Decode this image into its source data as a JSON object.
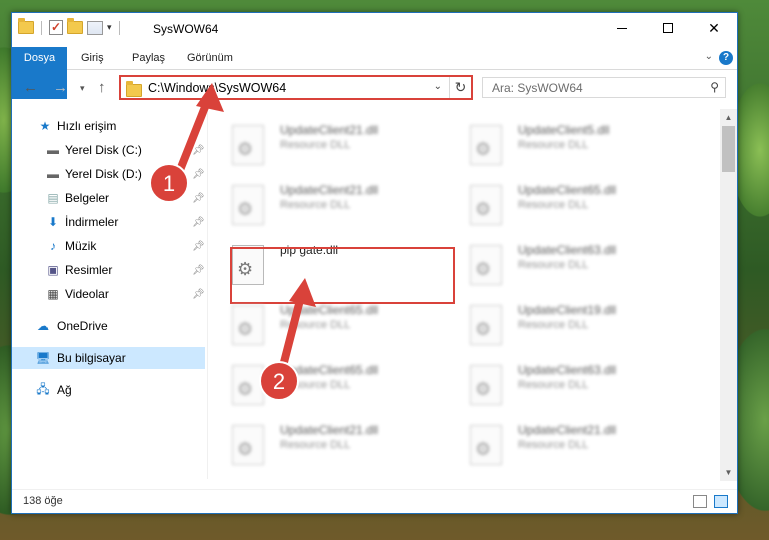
{
  "window": {
    "title": "SysWOW64",
    "controls": [
      "minimize",
      "maximize",
      "close"
    ]
  },
  "ribbon": {
    "tabs": [
      "Dosya",
      "Giriş",
      "Paylaş",
      "Görünüm"
    ]
  },
  "navigation": {
    "address": "C:\\Windows\\SysWOW64",
    "search_placeholder": "Ara: SysWOW64"
  },
  "sidebar": {
    "items": [
      {
        "label": "Hızlı erişim",
        "icon": "star-icon",
        "pinned": false
      },
      {
        "label": "Yerel Disk (C:)",
        "icon": "drive-icon",
        "pinned": true
      },
      {
        "label": "Yerel Disk (D:)",
        "icon": "drive-icon",
        "pinned": true
      },
      {
        "label": "Belgeler",
        "icon": "documents-icon",
        "pinned": true
      },
      {
        "label": "İndirmeler",
        "icon": "download-icon",
        "pinned": true
      },
      {
        "label": "Müzik",
        "icon": "music-icon",
        "pinned": true
      },
      {
        "label": "Resimler",
        "icon": "pictures-icon",
        "pinned": true
      },
      {
        "label": "Videolar",
        "icon": "video-icon",
        "pinned": true
      },
      {
        "label": "OneDrive",
        "icon": "cloud-icon",
        "pinned": false
      },
      {
        "label": "Bu bilgisayar",
        "icon": "computer-icon",
        "pinned": false,
        "selected": true
      },
      {
        "label": "Ağ",
        "icon": "network-icon",
        "pinned": false
      }
    ]
  },
  "files": {
    "highlighted": {
      "name": "pip gate.dll"
    },
    "left_column": [
      {
        "name": "UpdateClient21.dll",
        "type": "Resource DLL"
      },
      {
        "name": "UpdateClient21.dll",
        "type": "Resource DLL"
      },
      {
        "name": "UpdateClient65.dll",
        "type": "Resource DLL"
      },
      {
        "name": "UpdateClient65.dll",
        "type": "Resource DLL"
      },
      {
        "name": "UpdateClient21.dll",
        "type": "Resource DLL"
      }
    ],
    "right_column": [
      {
        "name": "UpdateClient5.dll",
        "type": "Resource DLL"
      },
      {
        "name": "UpdateClient65.dll",
        "type": "Resource DLL"
      },
      {
        "name": "UpdateClient63.dll",
        "type": "Resource DLL"
      },
      {
        "name": "UpdateClient19.dll",
        "type": "Resource DLL"
      },
      {
        "name": "UpdateClient63.dll",
        "type": "Resource DLL"
      },
      {
        "name": "UpdateClient21.dll",
        "type": "Resource DLL"
      }
    ]
  },
  "status": {
    "count": "138 öğe"
  },
  "annotations": {
    "step1": "1",
    "step2": "2",
    "color": "#d9423a"
  },
  "colors": {
    "accent": "#1979ca",
    "selection": "#cce8ff",
    "highlight": "#d9423a"
  }
}
